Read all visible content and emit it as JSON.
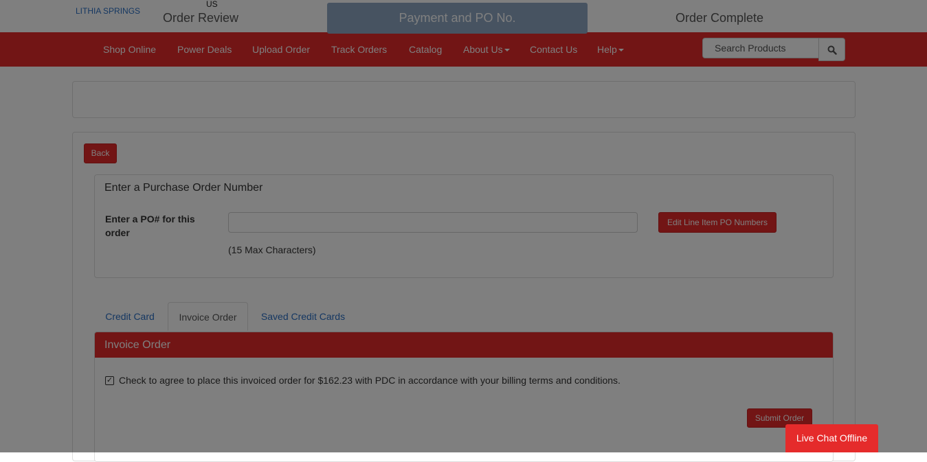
{
  "header": {
    "store_name": "LITHIA SPRINGS",
    "country": "US"
  },
  "nav": {
    "items": [
      {
        "label": "Shop Online",
        "dropdown": false
      },
      {
        "label": "Power Deals",
        "dropdown": false
      },
      {
        "label": "Upload Order",
        "dropdown": false
      },
      {
        "label": "Track Orders",
        "dropdown": false
      },
      {
        "label": "Catalog",
        "dropdown": false
      },
      {
        "label": "About Us",
        "dropdown": true
      },
      {
        "label": "Contact Us",
        "dropdown": false
      },
      {
        "label": "Help",
        "dropdown": true
      }
    ],
    "search": {
      "placeholder": "Search Products",
      "icon": "search-icon"
    }
  },
  "steps": [
    {
      "label": "Order Review",
      "active": false
    },
    {
      "label": "Payment and PO No.",
      "active": true
    },
    {
      "label": "Order Complete",
      "active": false
    }
  ],
  "back_label": "Back",
  "po": {
    "title": "Enter a Purchase Order Number",
    "field_label": "Enter a PO# for this order",
    "value": "",
    "hint": "(15 Max Characters)",
    "edit_line_items_label": "Edit Line Item PO Numbers"
  },
  "payment_tabs": [
    {
      "label": "Credit Card",
      "active": false
    },
    {
      "label": "Invoice Order",
      "active": true
    },
    {
      "label": "Saved Credit Cards",
      "active": false
    }
  ],
  "invoice": {
    "title": "Invoice Order",
    "checked": true,
    "agree_text": "Check to agree to place this invoiced order for $162.23 with PDC in accordance with your billing terms and conditions.",
    "submit_label": "Submit Order"
  },
  "chat_label": "Live Chat Offline",
  "colors": {
    "brand_red": "#e52b2b",
    "active_step": "#8fa7c2",
    "link_blue": "#2a6fc4"
  }
}
